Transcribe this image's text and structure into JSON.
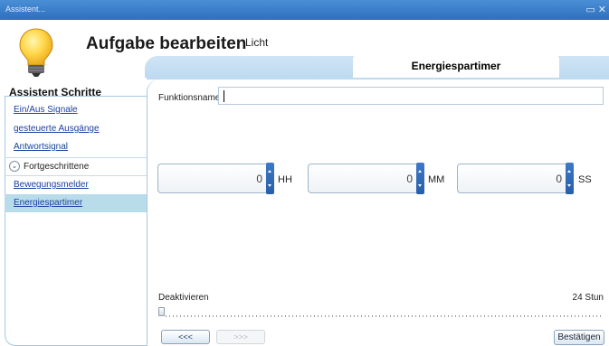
{
  "window": {
    "title": "Assistent...",
    "controls_icon": "maximize-close-icons"
  },
  "header": {
    "title": "Aufgabe bearbeiten",
    "subtitle": "Licht",
    "icon": "lightbulb-icon"
  },
  "tab": {
    "active_label": "Energiespartimer"
  },
  "sidebar": {
    "title": "Assistent Schritte",
    "items": [
      {
        "label": "Ein/Aus Signale"
      },
      {
        "label": "gesteuerte Ausgänge"
      },
      {
        "label": "Antwortsignal"
      }
    ],
    "group_label": "Fortgeschrittene",
    "group_items": [
      {
        "label": "Bewegungsmelder"
      },
      {
        "label": "Energiespartimer",
        "active": true
      }
    ]
  },
  "form": {
    "funktionsname_label": "Funktionsname",
    "funktionsname_value": "",
    "hours": {
      "value": "0",
      "unit": "HH"
    },
    "minutes": {
      "value": "0",
      "unit": "MM"
    },
    "seconds": {
      "value": "0",
      "unit": "SS"
    },
    "slider": {
      "min_label": "Deaktivieren",
      "max_label": "24 Stun",
      "level_fraction": 0
    }
  },
  "footer": {
    "prev_label": "<<<",
    "next_label": ">>>",
    "confirm_label": "Bestätigen"
  },
  "colors": {
    "titlebar": "#3a7fcf",
    "accent": "#2f6bb8",
    "active_sidebar": "#b9dceb"
  }
}
